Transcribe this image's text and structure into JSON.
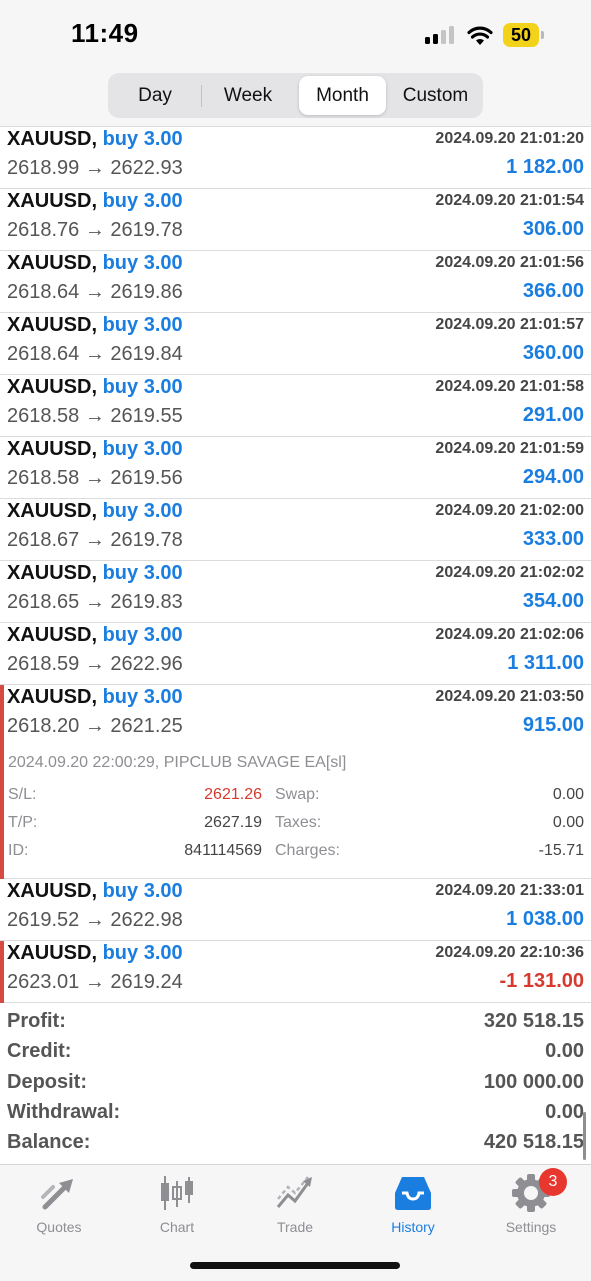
{
  "status": {
    "time": "11:49",
    "battery": "50"
  },
  "periods": [
    "Day",
    "Week",
    "Month",
    "Custom"
  ],
  "selected_period": "Month",
  "trades": [
    {
      "symbol": "XAUUSD,",
      "side": "buy 3.00",
      "prices": "2618.99 → 2622.93",
      "datetime": "2024.09.20 21:01:20",
      "profit": "1 182.00"
    },
    {
      "symbol": "XAUUSD,",
      "side": "buy 3.00",
      "prices": "2618.76 → 2619.78",
      "datetime": "2024.09.20 21:01:54",
      "profit": "306.00"
    },
    {
      "symbol": "XAUUSD,",
      "side": "buy 3.00",
      "prices": "2618.64 → 2619.86",
      "datetime": "2024.09.20 21:01:56",
      "profit": "366.00"
    },
    {
      "symbol": "XAUUSD,",
      "side": "buy 3.00",
      "prices": "2618.64 → 2619.84",
      "datetime": "2024.09.20 21:01:57",
      "profit": "360.00"
    },
    {
      "symbol": "XAUUSD,",
      "side": "buy 3.00",
      "prices": "2618.58 → 2619.55",
      "datetime": "2024.09.20 21:01:58",
      "profit": "291.00"
    },
    {
      "symbol": "XAUUSD,",
      "side": "buy 3.00",
      "prices": "2618.58 → 2619.56",
      "datetime": "2024.09.20 21:01:59",
      "profit": "294.00"
    },
    {
      "symbol": "XAUUSD,",
      "side": "buy 3.00",
      "prices": "2618.67 → 2619.78",
      "datetime": "2024.09.20 21:02:00",
      "profit": "333.00"
    },
    {
      "symbol": "XAUUSD,",
      "side": "buy 3.00",
      "prices": "2618.65 → 2619.83",
      "datetime": "2024.09.20 21:02:02",
      "profit": "354.00"
    },
    {
      "symbol": "XAUUSD,",
      "side": "buy 3.00",
      "prices": "2618.59 → 2622.96",
      "datetime": "2024.09.20 21:02:06",
      "profit": "1 311.00"
    },
    {
      "symbol": "XAUUSD,",
      "side": "buy 3.00",
      "prices": "2618.20 → 2621.25",
      "datetime": "2024.09.20 21:03:50",
      "profit": "915.00",
      "marked": true,
      "details": {
        "comment": "2024.09.20 22:00:29, PIPCLUB SAVAGE EA[sl]",
        "sl_label": "S/L:",
        "sl_value": "2621.26",
        "tp_label": "T/P:",
        "tp_value": "2627.19",
        "id_label": "ID:",
        "id_value": "841114569",
        "swap_label": "Swap:",
        "swap_value": "0.00",
        "taxes_label": "Taxes:",
        "taxes_value": "0.00",
        "charges_label": "Charges:",
        "charges_value": "-15.71"
      }
    },
    {
      "symbol": "XAUUSD,",
      "side": "buy 3.00",
      "prices": "2619.52 → 2622.98",
      "datetime": "2024.09.20 21:33:01",
      "profit": "1 038.00"
    },
    {
      "symbol": "XAUUSD,",
      "side": "buy 3.00",
      "prices": "2623.01 → 2619.24",
      "datetime": "2024.09.20 22:10:36",
      "profit": "-1 131.00",
      "marked": true,
      "negative": true
    }
  ],
  "summary": [
    {
      "label": "Profit:",
      "value": "320 518.15"
    },
    {
      "label": "Credit:",
      "value": "0.00"
    },
    {
      "label": "Deposit:",
      "value": "100 000.00"
    },
    {
      "label": "Withdrawal:",
      "value": "0.00"
    },
    {
      "label": "Balance:",
      "value": "420 518.15"
    }
  ],
  "tabs": [
    {
      "label": "Quotes",
      "icon": "quotes-arrows-icon"
    },
    {
      "label": "Chart",
      "icon": "candlestick-chart-icon"
    },
    {
      "label": "Trade",
      "icon": "trade-trend-icon"
    },
    {
      "label": "History",
      "icon": "history-inbox-icon",
      "active": true
    },
    {
      "label": "Settings",
      "icon": "settings-gear-icon",
      "badge": "3"
    }
  ],
  "colors": {
    "accent": "#1a7ee0",
    "negative": "#d63a2e",
    "marker": "#d64a3f",
    "badge": "#e8372e",
    "battery": "#f3d21a"
  }
}
